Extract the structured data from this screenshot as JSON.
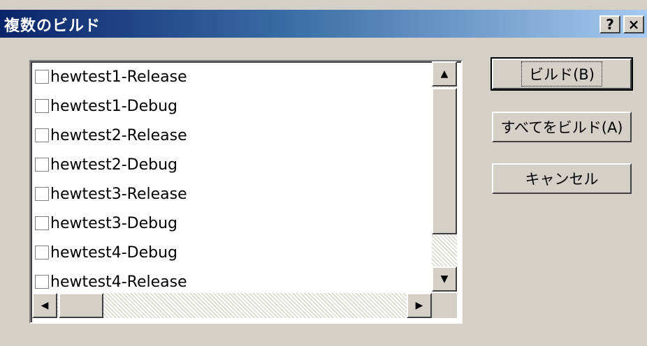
{
  "window": {
    "title": "複数のビルド"
  },
  "titlebar": {
    "help_label": "?",
    "close_label": "×"
  },
  "list": {
    "items": [
      {
        "label": "hewtest1-Release",
        "checked": false
      },
      {
        "label": "hewtest1-Debug",
        "checked": false
      },
      {
        "label": "hewtest2-Release",
        "checked": false
      },
      {
        "label": "hewtest2-Debug",
        "checked": false
      },
      {
        "label": "hewtest3-Release",
        "checked": false
      },
      {
        "label": "hewtest3-Debug",
        "checked": false
      },
      {
        "label": "hewtest4-Debug",
        "checked": false
      },
      {
        "label": "hewtest4-Release",
        "checked": false
      }
    ]
  },
  "buttons": {
    "build": "ビルド(B)",
    "build_all": "すべてをビルド(A)",
    "cancel": "キャンセル"
  },
  "scroll": {
    "up": "▲",
    "down": "▼",
    "left": "◀",
    "right": "▶"
  }
}
